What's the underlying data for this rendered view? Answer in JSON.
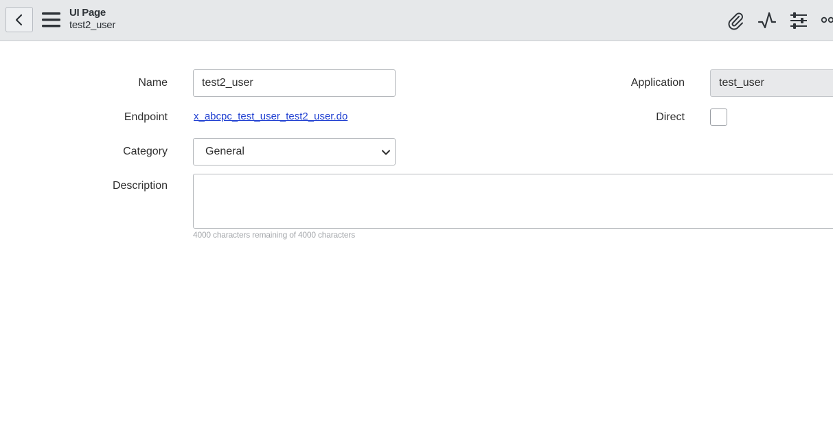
{
  "header": {
    "title": "UI Page",
    "subtitle": "test2_user",
    "icons": [
      "chevron-left-icon",
      "hamburger-menu-icon",
      "paperclip-icon",
      "activity-pulse-icon",
      "sliders-icon",
      "more-options-icon"
    ]
  },
  "form": {
    "name_label": "Name",
    "name_value": "test2_user",
    "endpoint_label": "Endpoint",
    "endpoint_value": "x_abcpc_test_user_test2_user.do",
    "category_label": "Category",
    "category_value": "General",
    "description_label": "Description",
    "description_value": "",
    "description_counter": "4000 characters remaining of 4000 characters",
    "application_label": "Application",
    "application_value": "test_user",
    "direct_label": "Direct",
    "direct_checked": false
  },
  "colors": {
    "header_bg": "#e6e8ea",
    "link": "#1f3fd1",
    "readonly_bg": "#e8e9eb"
  }
}
